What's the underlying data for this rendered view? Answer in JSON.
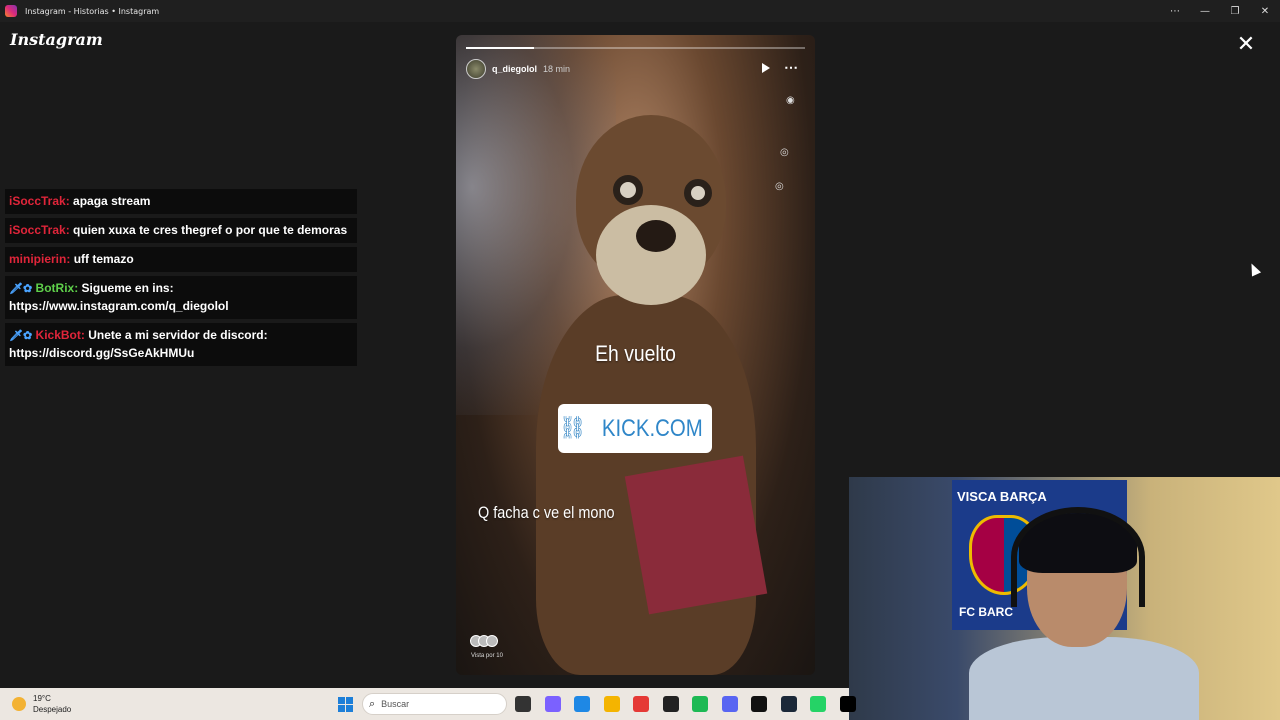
{
  "window": {
    "title": "Instagram - Historias • Instagram",
    "controls": [
      "⋯",
      "—",
      "❐",
      "✕"
    ]
  },
  "instagram": {
    "logo": "Instagram",
    "close_glyph": "✕"
  },
  "chat": {
    "messages": [
      {
        "user": "iSoccTrak:",
        "text": "apaga stream",
        "user_color": "#e0253a",
        "badges": ""
      },
      {
        "user": "iSoccTrak:",
        "text": "quien xuxa te cres thegref o por que te demoras",
        "user_color": "#e0253a",
        "badges": ""
      },
      {
        "user": "minipierin:",
        "text": "uff temazo",
        "user_color": "#e0253a",
        "badges": ""
      },
      {
        "user": "BotRix:",
        "text": "Sigueme en ins: https://www.instagram.com/q_diegolol",
        "user_color": "#5fd04b",
        "badges": "🗡✿"
      },
      {
        "user": "KickBot:",
        "text": "Unete a mi servidor de discord: https://discord.gg/SsGeAkHMUu",
        "user_color": "#e0253a",
        "badges": "🗡✿"
      }
    ]
  },
  "story": {
    "username": "q_diegolol",
    "time": "18 min",
    "progress": 0.2,
    "caption_top": "Eh vuelto",
    "link_text": "KICK.COM",
    "caption_bottom": "Q facha c ve el mono",
    "viewed_by": "Vista por 10",
    "play_icon": "play-icon",
    "more_icon": "⋯"
  },
  "webcam": {
    "flag_text": "VISCA BARÇA",
    "flag_text_bottom": "FC BARC",
    "crest_text": "FCB"
  },
  "taskbar": {
    "weather_temp": "19°C",
    "weather_desc": "Despejado",
    "search_placeholder": "Buscar",
    "apps": [
      {
        "name": "task-view",
        "color": "#333333"
      },
      {
        "name": "copilot",
        "color": "#7b61ff"
      },
      {
        "name": "store",
        "color": "#1e88e5"
      },
      {
        "name": "file-explorer",
        "color": "#f4b400"
      },
      {
        "name": "opera",
        "color": "#e53935"
      },
      {
        "name": "obs",
        "color": "#222222"
      },
      {
        "name": "spotify",
        "color": "#1db954"
      },
      {
        "name": "discord",
        "color": "#5865f2"
      },
      {
        "name": "epic-games",
        "color": "#111111"
      },
      {
        "name": "steam",
        "color": "#1b2838"
      },
      {
        "name": "whatsapp",
        "color": "#25d366"
      },
      {
        "name": "tiktok",
        "color": "#000000"
      }
    ]
  }
}
